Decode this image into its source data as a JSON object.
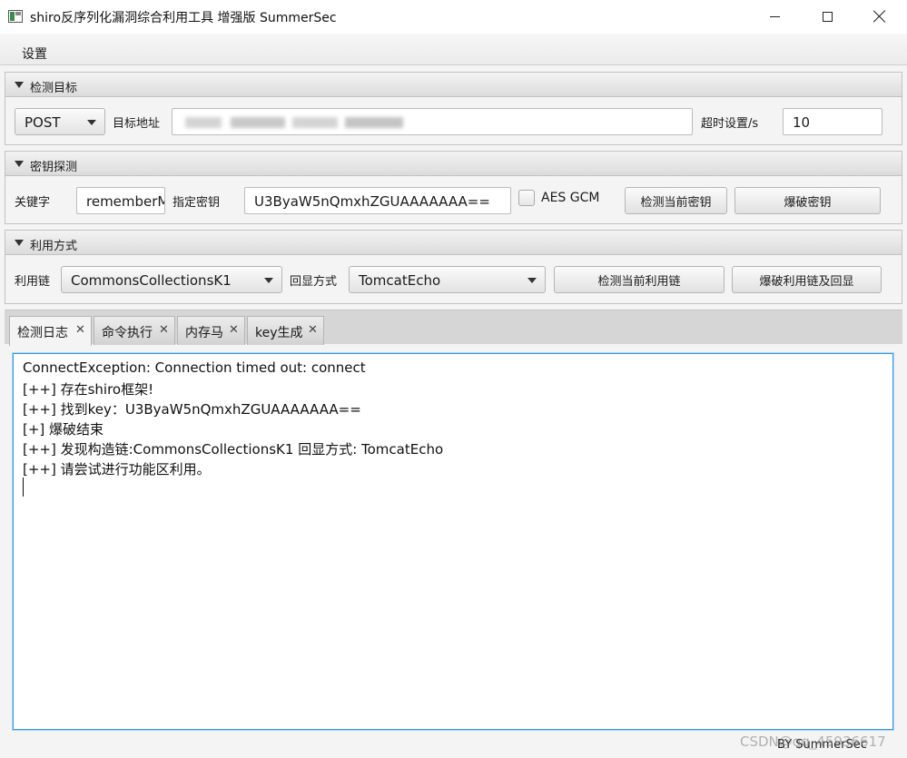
{
  "window": {
    "title": "shiro反序列化漏洞综合利用工具 增强版 SummerSec",
    "icon": "app-window-icon",
    "controls": [
      "minimize-icon",
      "maximize-icon",
      "close-icon"
    ]
  },
  "menu": {
    "settings": "设置"
  },
  "target_pane": {
    "title": "检测目标",
    "method": "POST",
    "url_label": "目标地址",
    "timeout_label": "超时设置/s",
    "timeout_value": "10"
  },
  "key_pane": {
    "title": "密钥探测",
    "keyword_label": "关键字",
    "keyword_value": "rememberMe",
    "key_label": "指定密钥",
    "key_value": "U3ByaW5nQmxhZGUAAAAAAA==",
    "aes_gcm_label": "AES GCM",
    "aes_gcm_checked": false,
    "check_key_button": "检测当前密钥",
    "brute_key_button": "爆破密钥"
  },
  "exploit_pane": {
    "title": "利用方式",
    "chain_label": "利用链",
    "chain_value": "CommonsCollectionsK1",
    "echo_label": "回显方式",
    "echo_value": "TomcatEcho",
    "check_chain_button": "检测当前利用链",
    "brute_chain_button": "爆破利用链及回显"
  },
  "tabs": [
    {
      "label": "检测日志",
      "active": true
    },
    {
      "label": "命令执行",
      "active": false
    },
    {
      "label": "内存马",
      "active": false
    },
    {
      "label": "key生成",
      "active": false
    }
  ],
  "tab_close_glyph": "✕",
  "log_lines": [
    "ConnectException: Connection timed out: connect",
    "[++] 存在shiro框架!",
    "[++] 找到key：U3ByaW5nQmxhZGUAAAAAAA==",
    "[+] 爆破结束",
    "[++] 发现构造链:CommonsCollectionsK1  回显方式: TomcatEcho",
    "[++] 请尝试进行功能区利用。"
  ],
  "footer": "BY  SummerSec",
  "watermark": "CSDN@qq_45936617",
  "colors": {
    "log_border": "#3a9ad9",
    "pane_header": "#dcdcdc",
    "background": "#f4f4f4"
  }
}
